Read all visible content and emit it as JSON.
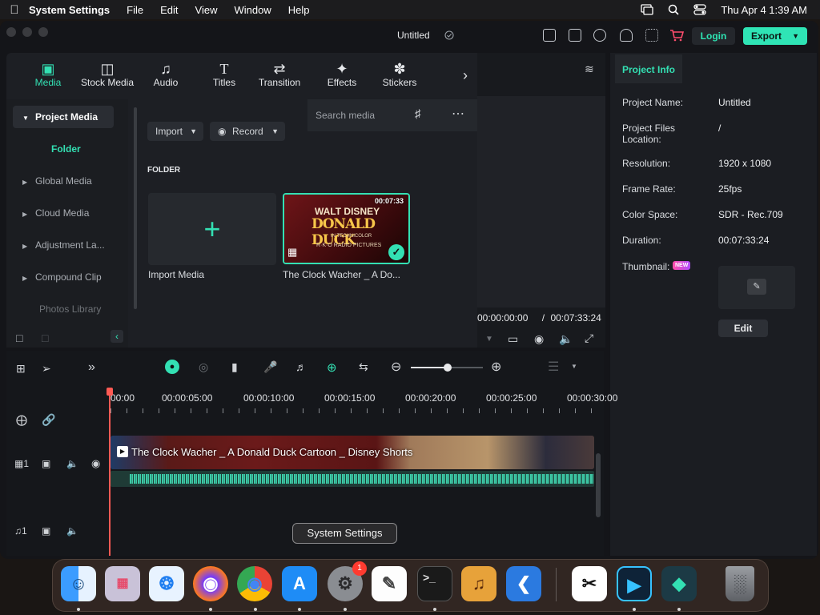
{
  "menubar": {
    "app_name": "System Settings",
    "items": [
      "File",
      "Edit",
      "View",
      "Window",
      "Help"
    ],
    "clock": "Thu Apr 4  1:39 AM"
  },
  "window": {
    "title": "Untitled",
    "login_label": "Login",
    "export_label": "Export"
  },
  "media": {
    "tabs": [
      "Media",
      "Stock Media",
      "Audio",
      "Titles",
      "Transition",
      "Effects",
      "Stickers"
    ],
    "sidebar": {
      "project_media": "Project Media",
      "folder": "Folder",
      "items": [
        "Global Media",
        "Cloud Media",
        "Adjustment La...",
        "Compound Clip"
      ],
      "photos": "Photos Library"
    },
    "import_label": "Import",
    "record_label": "Record",
    "search_placeholder": "Search media",
    "folder_heading": "FOLDER",
    "import_media_label": "Import Media",
    "clip": {
      "name": "The Clock Wacher _ A Do...",
      "duration": "00:07:33",
      "poster_line1": "WALT DISNEY",
      "poster_line2": "DONALD DUCK",
      "poster_line3": "IN TECHNICOLOR",
      "poster_line4": "R·K·O RADIO PICTURES"
    }
  },
  "player": {
    "current_time": "00:00:00:00",
    "separator": "/",
    "total_time": "00:07:33:24"
  },
  "info": {
    "tab": "Project Info",
    "rows": [
      {
        "key": "Project Name:",
        "value": "Untitled"
      },
      {
        "key": "Project Files Location:",
        "value": "/"
      },
      {
        "key": "Resolution:",
        "value": "1920 x 1080"
      },
      {
        "key": "Frame Rate:",
        "value": "25fps"
      },
      {
        "key": "Color Space:",
        "value": "SDR - Rec.709"
      },
      {
        "key": "Duration:",
        "value": "00:07:33:24"
      }
    ],
    "thumbnail_label": "Thumbnail:",
    "new_badge": "NEW",
    "edit_label": "Edit"
  },
  "timeline": {
    "ruler": [
      "00:00",
      "00:00:05:00",
      "00:00:10:00",
      "00:00:15:00",
      "00:00:20:00",
      "00:00:25:00",
      "00:00:30:00"
    ],
    "clip_title": "The Clock Wacher _ A Donald Duck Cartoon _ Disney Shorts",
    "video_track_num": "1",
    "audio_track_num": "1"
  },
  "dock": {
    "tooltip": "System Settings",
    "badge": "1",
    "apps": [
      "Finder",
      "Launchpad",
      "Safari",
      "Firefox",
      "Chrome",
      "App Store",
      "System Settings",
      "TextEdit",
      "Terminal",
      "GarageBand",
      "VS Code",
      "CapCut",
      "Screen Recorder",
      "Filmora",
      "Trash"
    ]
  },
  "colors": {
    "accent": "#33e0b3",
    "playhead": "#ff5a54",
    "panel": "#1d1f24"
  }
}
